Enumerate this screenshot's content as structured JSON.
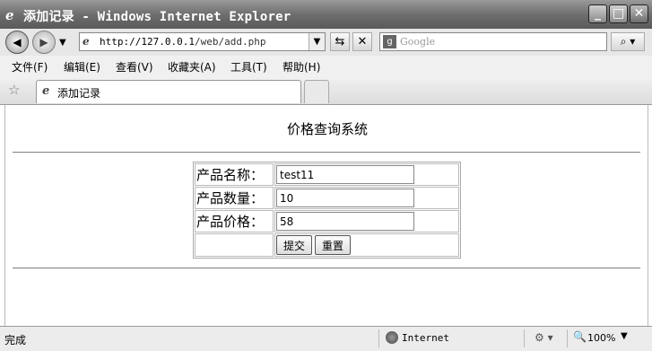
{
  "window": {
    "title": "添加记录 - Windows Internet Explorer",
    "ie_glyph": "e"
  },
  "window_controls": {
    "minimize": "_",
    "maximize": "□",
    "close": "✕"
  },
  "address_bar": {
    "url_host": "http://127.0.0.1",
    "url_path": "/web/add.php",
    "search_placeholder": "Google"
  },
  "menu": [
    "文件(F)",
    "编辑(E)",
    "查看(V)",
    "收藏夹(A)",
    "工具(T)",
    "帮助(H)"
  ],
  "tabs": [
    {
      "label": "添加记录"
    }
  ],
  "page": {
    "heading": "价格查询系统",
    "form": {
      "rows": [
        {
          "label": "产品名称：",
          "value": "test11"
        },
        {
          "label": "产品数量：",
          "value": "10"
        },
        {
          "label": "产品价格：",
          "value": "58"
        }
      ],
      "submit_label": "提交",
      "reset_label": "重置"
    }
  },
  "status_bar": {
    "status": "完成",
    "zone": "Internet",
    "zoom": "100%"
  },
  "icons": [
    "back-icon",
    "forward-icon",
    "refresh-icon",
    "stop-icon",
    "search-icon",
    "favorites-star-icon",
    "ie-page-icon",
    "internet-zone-icon",
    "zoom-icon"
  ]
}
